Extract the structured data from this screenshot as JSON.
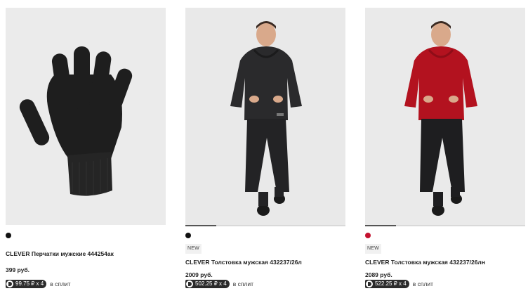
{
  "products": [
    {
      "name": "CLEVER Перчатки мужские 444254ак",
      "price": "399 руб.",
      "split_amount": "99.75 ₽ x 4",
      "split_label": "в сплит",
      "swatch_color": "#111111",
      "image_subject": "gloves-image",
      "badge": ""
    },
    {
      "name": "CLEVER Толстовка мужская 432237/26л",
      "price": "2009 руб.",
      "split_amount": "502.25 ₽ x 4",
      "split_label": "в сплит",
      "swatch_color": "#111111",
      "image_subject": "man-in-black-hoodie-image",
      "badge": "NEW"
    },
    {
      "name": "CLEVER Толстовка мужская 432237/26лн",
      "price": "2089 руб.",
      "split_amount": "522.25 ₽ x 4",
      "split_label": "в сплит",
      "swatch_color": "#c4122f",
      "image_subject": "man-in-red-hoodie-image",
      "badge": "NEW"
    }
  ]
}
